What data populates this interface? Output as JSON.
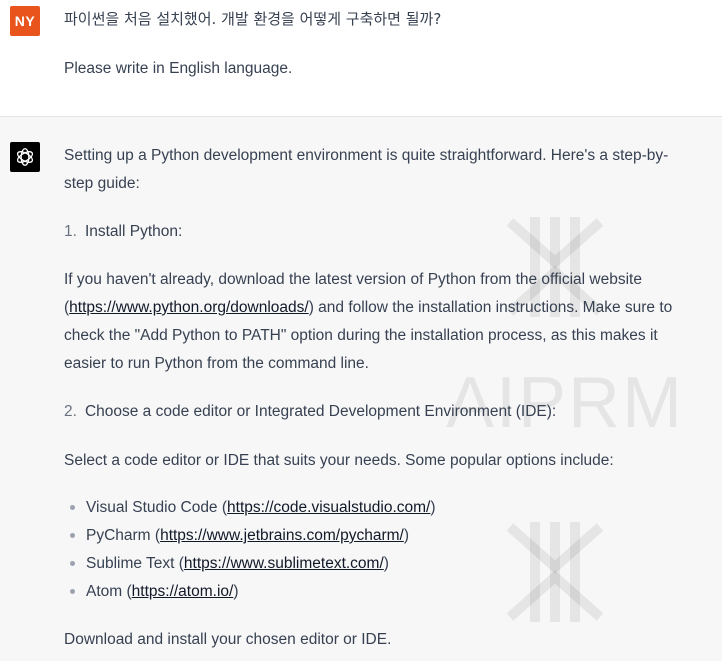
{
  "user": {
    "avatar": "NY",
    "avatar_color": "#e8541c",
    "message_line1": "파이썬을 처음 설치했어. 개발 환경을 어떻게 구축하면 될까?",
    "message_line2": "Please write in English language."
  },
  "assistant": {
    "avatar_icon": "openai-logo-icon",
    "intro_line1": "Setting up a Python development environment is quite straightforward. Here's a step-by-",
    "intro_line2": "step guide:",
    "step1": {
      "num": "1.",
      "title": "Install Python:"
    },
    "step1_body": {
      "pre": "If you haven't already, download the latest version of Python from the official website",
      "paren_open": "(",
      "link": "https://www.python.org/downloads/",
      "post1": ") and follow the installation instructions. Make sure to",
      "line3": "check the \"Add Python to PATH\" option during the installation process, as this makes it",
      "line4": "easier to run Python from the command line."
    },
    "step2": {
      "num": "2.",
      "title": "Choose a code editor or Integrated Development Environment (IDE):"
    },
    "step2_body": "Select a code editor or IDE that suits your needs. Some popular options include:",
    "editors": [
      {
        "name": "Visual Studio Code",
        "url": "https://code.visualstudio.com/"
      },
      {
        "name": "PyCharm",
        "url": "https://www.jetbrains.com/pycharm/"
      },
      {
        "name": "Sublime Text",
        "url": "https://www.sublimetext.com/"
      },
      {
        "name": "Atom",
        "url": "https://atom.io/"
      }
    ],
    "closing": "Download and install your chosen editor or IDE."
  },
  "watermark": {
    "text": "AIPRM"
  }
}
